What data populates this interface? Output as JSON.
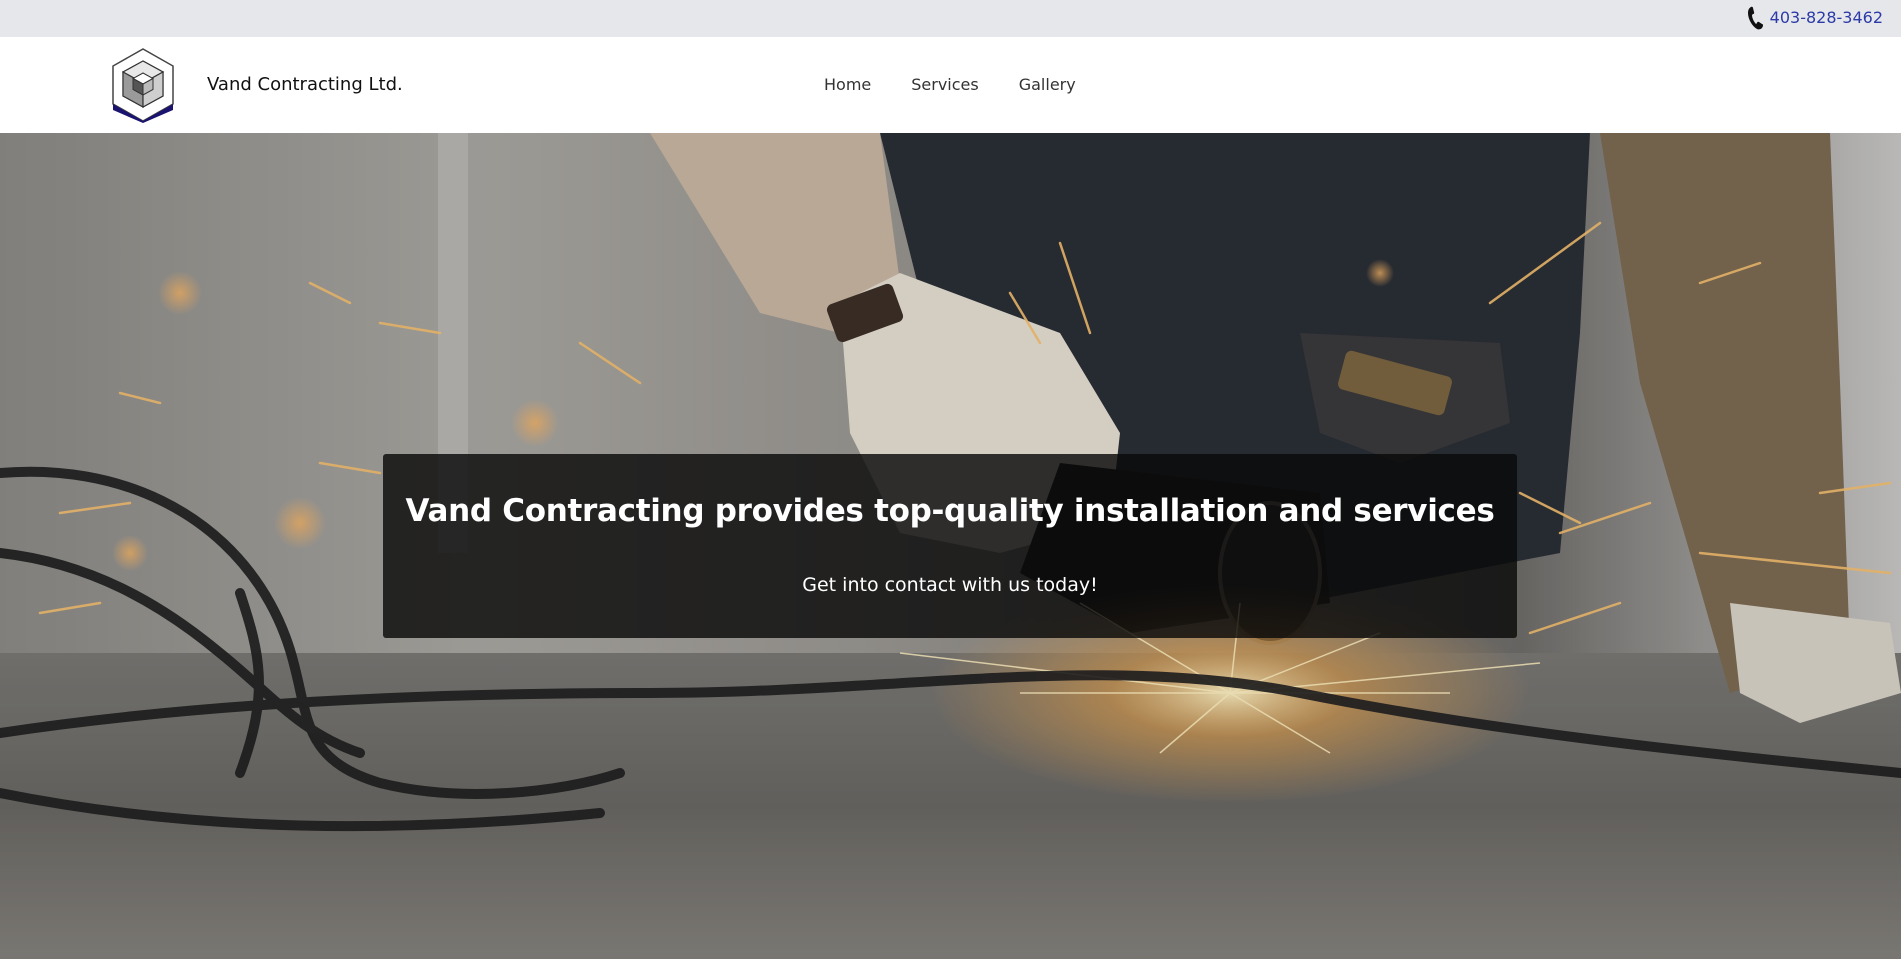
{
  "topbar": {
    "phone_icon": "phone-icon",
    "phone_number": "403-828-3462",
    "phone_color": "#2b3aa8"
  },
  "header": {
    "logo_icon": "cube-hexagon-logo",
    "brand": "Vand Contracting Ltd.",
    "nav": [
      {
        "label": "Home"
      },
      {
        "label": "Services"
      },
      {
        "label": "Gallery"
      }
    ]
  },
  "hero": {
    "background": "worker-angle-grinder-sparks-photo",
    "title": "Vand Contracting provides top-quality installation and services",
    "subtitle": "Get into contact with us today!"
  }
}
